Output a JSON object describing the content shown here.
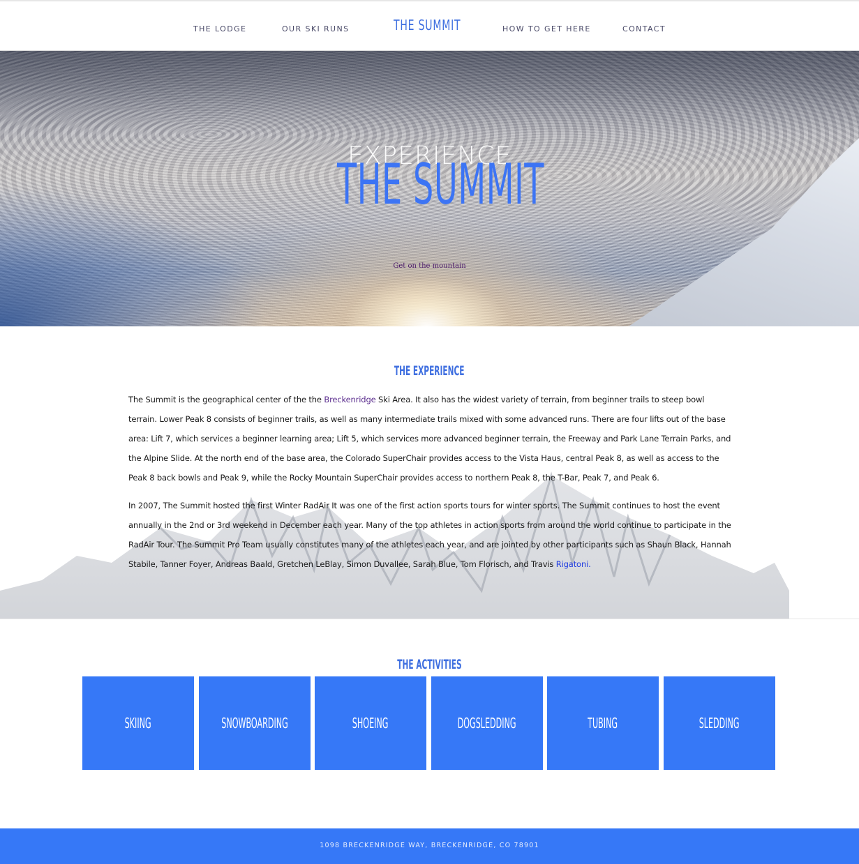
{
  "nav": {
    "items": [
      "THE LODGE",
      "OUR SKI RUNS",
      "HOW TO GET HERE",
      "CONTACT"
    ],
    "brand": "THE SUMMIT"
  },
  "hero": {
    "eyebrow": "EXPERIENCE",
    "title": "THE SUMMIT",
    "cta": "Get on the mountain"
  },
  "experience": {
    "title": "THE EXPERIENCE",
    "p1_a": "The Summit is the geographical center of the the ",
    "p1_link": "Breckenridge",
    "p1_b": " Ski Area. It also has the widest variety of terrain, from beginner trails to steep bowl terrain. Lower Peak 8 consists of beginner trails, as well as many intermediate trails mixed with some advanced runs. There are four lifts out of the base area: Lift 7, which services a beginner learning area; Lift 5, which services more advanced beginner terrain, the Freeway and Park Lane Terrain Parks, and the Alpine Slide. At the north end of the base area, the Colorado SuperChair provides access to the Vista Haus, central Peak 8, as well as access to the Peak 8 back bowls and Peak 9, while the Rocky Mountain SuperChair provides access to northern Peak 8, the T-Bar, Peak 7, and Peak 6.",
    "p2_a": "In 2007, The Summit hosted the first Winter RadAir It was one of the first action sports tours for winter sports. The Summit continues to host the event annually in the 2nd or 3rd weekend in December each year. Many of the top athletes in action sports from around the world continue to participate in the RadAir Tour. The Summit Pro Team usually constitutes many of the athletes each year, and are jointed by other participants such as Shaun Black, Hannah Stabile, Tanner Foyer, Andreas Baald, Gretchen LeBlay, Simon Duvallee, Sarah Blue, Tom Florisch, and Travis ",
    "p2_link": "Rigatoni."
  },
  "activities": {
    "title": "THE ACTIVITIES",
    "items": [
      "SKIING",
      "SNOWBOARDING",
      "SHOEING",
      "DOGSLEDDING",
      "TUBING",
      "SLEDDING"
    ]
  },
  "footer": {
    "address": "1098 BRECKENRIDGE WAY, BRECKENRIDGE, CO 78901"
  },
  "colors": {
    "accent": "#3678f7",
    "link_visited": "#5b2d8e",
    "link": "#1f3be0"
  }
}
